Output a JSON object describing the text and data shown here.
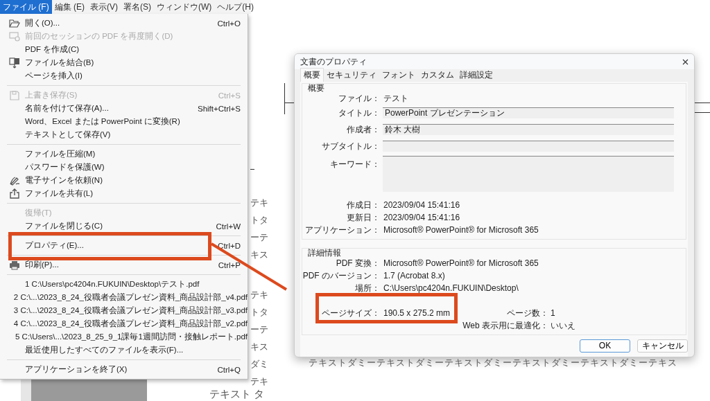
{
  "menu_bar": [
    {
      "label": "ファイル (F)",
      "selected": true
    },
    {
      "label": "編集 (E)",
      "selected": false
    },
    {
      "label": "表示(V)",
      "selected": false
    },
    {
      "label": "署名(S)",
      "selected": false
    },
    {
      "label": "ウィンドウ(W)",
      "selected": false
    },
    {
      "label": "ヘルプ(H)",
      "selected": false
    }
  ],
  "file_menu": [
    {
      "kind": "item",
      "label": "開く(O)...",
      "shortcut": "Ctrl+O",
      "disabled": false
    },
    {
      "kind": "item",
      "label": "前回のセッションの PDF を再度開く(D)",
      "disabled": true
    },
    {
      "kind": "item",
      "label": "PDF を作成(C)",
      "disabled": false
    },
    {
      "kind": "item",
      "label": "ファイルを結合(B)",
      "disabled": false
    },
    {
      "kind": "item",
      "label": "ページを挿入(I)",
      "disabled": false
    },
    {
      "kind": "separator"
    },
    {
      "kind": "item",
      "label": "上書き保存(S)",
      "shortcut": "Ctrl+S",
      "disabled": true
    },
    {
      "kind": "item",
      "label": "名前を付けて保存(A)...",
      "shortcut": "Shift+Ctrl+S",
      "disabled": false
    },
    {
      "kind": "item",
      "label": "Word、Excel または PowerPoint に変換(R)",
      "disabled": false
    },
    {
      "kind": "item",
      "label": "テキストとして保存(V)",
      "disabled": false
    },
    {
      "kind": "separator"
    },
    {
      "kind": "item",
      "label": "ファイルを圧縮(M)",
      "disabled": false
    },
    {
      "kind": "item",
      "label": "パスワードを保護(W)",
      "disabled": false
    },
    {
      "kind": "item",
      "label": "電子サインを依頼(N)",
      "disabled": false
    },
    {
      "kind": "item",
      "label": "ファイルを共有(L)",
      "disabled": false
    },
    {
      "kind": "separator"
    },
    {
      "kind": "item",
      "label": "復帰(T)",
      "disabled": true
    },
    {
      "kind": "item",
      "label": "ファイルを閉じる(C)",
      "shortcut": "Ctrl+W",
      "disabled": false
    },
    {
      "kind": "separator"
    },
    {
      "kind": "item",
      "label": "プロパティ(E)...",
      "shortcut": "Ctrl+D",
      "disabled": false
    },
    {
      "kind": "separator"
    },
    {
      "kind": "item",
      "label": "印刷(P)...",
      "shortcut": "Ctrl+P",
      "disabled": false
    },
    {
      "kind": "separator"
    },
    {
      "kind": "item",
      "label": "1 C:\\Users\\pc4204n.FUKUIN\\Desktop\\テスト.pdf",
      "disabled": false
    },
    {
      "kind": "item",
      "label": "2 C:\\...\\2023_8_24_役職者会議プレゼン資料_商品設計部_v4.pdf",
      "disabled": false
    },
    {
      "kind": "item",
      "label": "3 C:\\...\\2023_8_24_役職者会議プレゼン資料_商品設計部_v3.pdf",
      "disabled": false
    },
    {
      "kind": "item",
      "label": "4 C:\\...\\2023_8_24_役職者会議プレゼン資料_商品設計部_v2.pdf",
      "disabled": false
    },
    {
      "kind": "item",
      "label": "5 C:\\Users\\...\\2023_8_25_9_1課毎1週間訪問・接触レポート.pdf",
      "disabled": false
    },
    {
      "kind": "item",
      "label": "最近使用したすべてのファイルを表示(F)...",
      "disabled": false
    },
    {
      "kind": "separator"
    },
    {
      "kind": "item",
      "label": "アプリケーションを終了(X)",
      "shortcut": "Ctrl+Q",
      "disabled": false
    }
  ],
  "document_fragments": [
    "テキ",
    "トタ",
    "ーテ",
    "キス",
    "テキ",
    "トタ",
    "ーテ",
    "キス",
    "ダミ",
    "テキ"
  ],
  "document_bottom_text": "テキスト タ",
  "dialog": {
    "title": "文書のプロパティ",
    "tabs": [
      {
        "label": "概要",
        "selected": true
      },
      {
        "label": "セキュリティ",
        "selected": false
      },
      {
        "label": "フォント",
        "selected": false
      },
      {
        "label": "カスタム",
        "selected": false
      },
      {
        "label": "詳細設定",
        "selected": false
      }
    ],
    "summary": {
      "heading": "概要",
      "rows": [
        {
          "kind": "text",
          "label": "ファイル：",
          "value": "テスト"
        },
        {
          "kind": "field",
          "label": "タイトル：",
          "value": "PowerPoint プレゼンテーション"
        },
        {
          "kind": "field",
          "label": "作成者：",
          "value": "鈴木 大樹"
        },
        {
          "kind": "field",
          "label": "サブタイトル："
        },
        {
          "kind": "area",
          "label": "キーワード："
        },
        {
          "kind": "text",
          "label": "作成日：",
          "value": "2023/09/04 15:41:16"
        },
        {
          "kind": "text",
          "label": "更新日：",
          "value": "2023/09/04 15:41:16"
        },
        {
          "kind": "text",
          "label": "アプリケーション：",
          "value": "Microsoft® PowerPoint® for Microsoft 365"
        }
      ]
    },
    "details": {
      "heading": "詳細情報",
      "rows": [
        {
          "label": "PDF 変換：",
          "value": "Microsoft® PowerPoint® for Microsoft 365"
        },
        {
          "label": "PDF のバージョン：",
          "value": "1.7 (Acrobat 8.x)"
        },
        {
          "label": "場所：",
          "value": "C:\\Users\\pc4204n.FUKUIN\\Desktop\\"
        },
        {
          "label": "ページサイズ：",
          "value": "190.5 x 275.2 mm",
          "right_label": "ページ数：",
          "right_value": "1"
        },
        {
          "right_label": "Web 表示用に最適化：",
          "right_value": "いいえ"
        }
      ]
    },
    "buttons": [
      {
        "label": "OK",
        "default": true
      },
      {
        "label": "キャンセル",
        "default": false
      }
    ]
  },
  "background_text": "テキストダミーテキストダミーテキストダミーテキストダミーテキストダミーテキス"
}
